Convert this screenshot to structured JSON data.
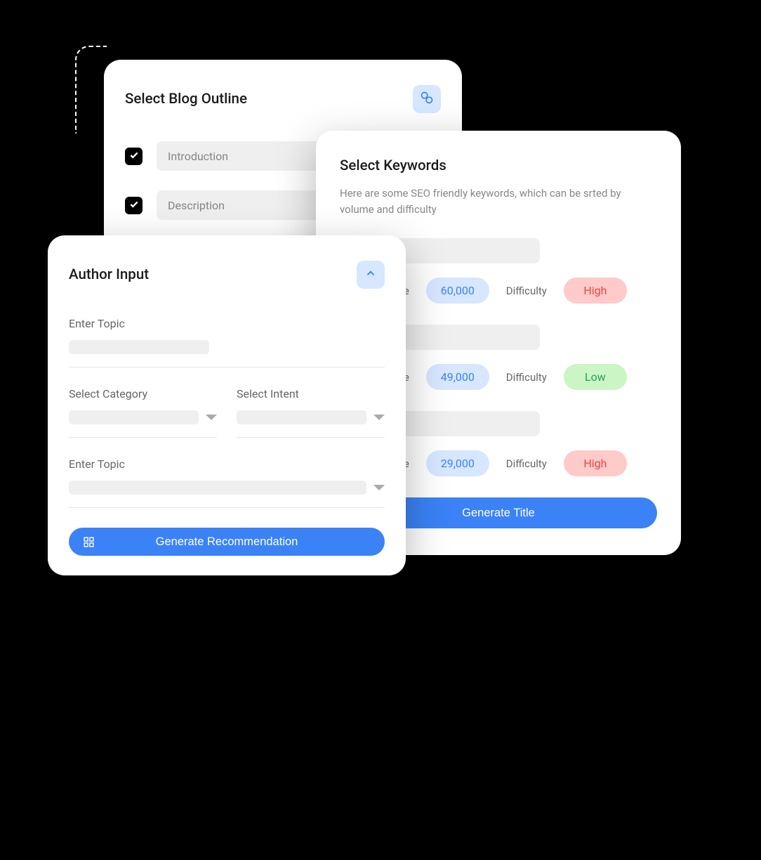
{
  "outline": {
    "title": "Select Blog Outline",
    "items": [
      {
        "label": "Introduction",
        "checked": true
      },
      {
        "label": "Description",
        "checked": true
      }
    ]
  },
  "keywords": {
    "title": "Select Keywords",
    "subtitle": "Here are some SEO friendly keywords, which can be srted by volume and difficulty",
    "volume_label": "Volume",
    "difficulty_label": "Difficulty",
    "rows": [
      {
        "volume": "60,000",
        "difficulty": "High",
        "difficulty_level": "high"
      },
      {
        "volume": "49,000",
        "difficulty": "Low",
        "difficulty_level": "low"
      },
      {
        "volume": "29,000",
        "difficulty": "High",
        "difficulty_level": "high"
      }
    ],
    "button": "Generate Title"
  },
  "author": {
    "title": "Author Input",
    "field_topic": "Enter Topic",
    "field_category": "Select Category",
    "field_intent": "Select Intent",
    "field_topic2": "Enter Topic",
    "button": "Generate Recommendation"
  }
}
